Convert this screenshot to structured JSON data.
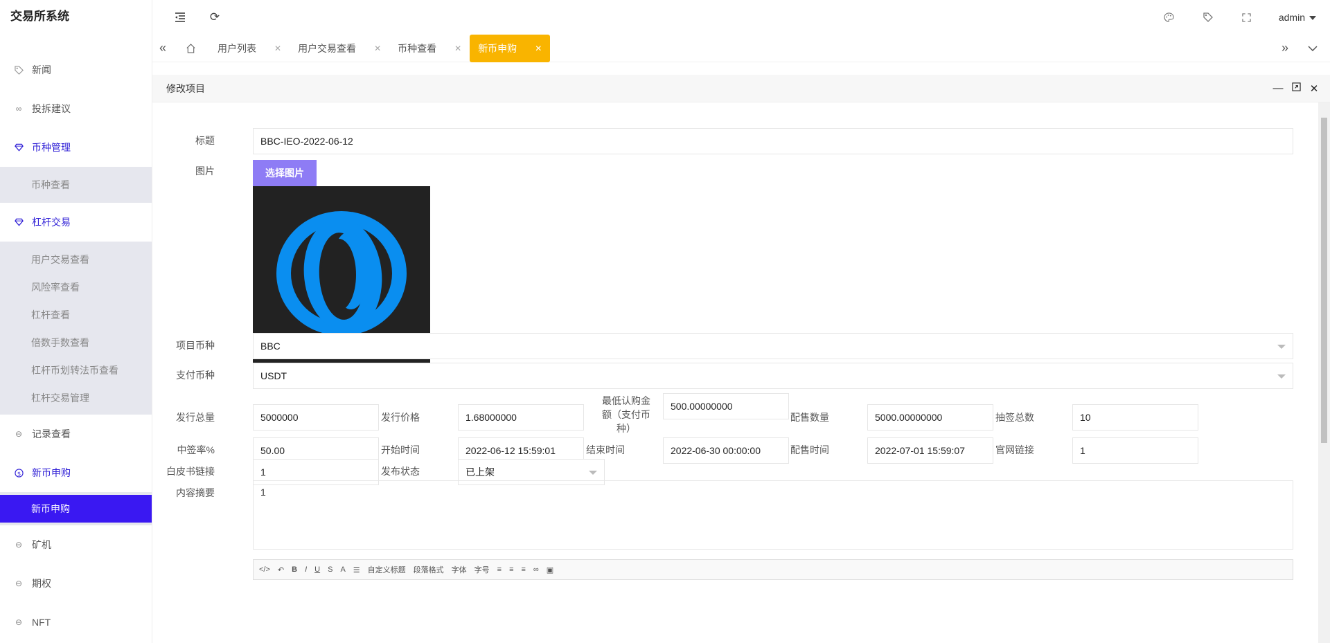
{
  "brand": "交易所系统",
  "sidebar": {
    "items": [
      {
        "label": "新闻"
      },
      {
        "label": "投拆建议"
      },
      {
        "label": "币种管理"
      },
      {
        "label": "杠杆交易"
      },
      {
        "label": "记录查看"
      },
      {
        "label": "新币申购"
      },
      {
        "label": "矿机"
      },
      {
        "label": "期权"
      },
      {
        "label": "NFT"
      }
    ],
    "coin_sub": [
      "币种查看"
    ],
    "lever_sub": [
      "用户交易查看",
      "风险率查看",
      "杠杆查看",
      "倍数手数查看",
      "杠杆币划转法币查看",
      "杠杆交易管理"
    ],
    "ipo_sub": [
      "新币申购"
    ]
  },
  "topbar": {
    "user": "admin"
  },
  "tabs": [
    {
      "label": "用户列表"
    },
    {
      "label": "用户交易查看"
    },
    {
      "label": "币种查看"
    },
    {
      "label": "新币申购"
    }
  ],
  "panel": {
    "title": "修改项目"
  },
  "form": {
    "title_label": "标题",
    "title_value": "BBC-IEO-2022-06-12",
    "image_label": "图片",
    "choose_image": "选择图片",
    "coin_label": "项目币种",
    "coin_value": "BBC",
    "pay_label": "支付币种",
    "pay_value": "USDT",
    "total_label": "发行总量",
    "total_value": "5000000",
    "price_label": "发行价格",
    "price_value": "1.68000000",
    "min_label": "最低认购金额（支付币种）",
    "min_value": "500.00000000",
    "alloc_label": "配售数量",
    "alloc_value": "5000.00000000",
    "lottery_label": "抽签总数",
    "lottery_value": "10",
    "rate_label": "中签率%",
    "rate_value": "50.00",
    "start_label": "开始时间",
    "start_value": "2022-06-12 15:59:01",
    "end_label": "结束时间",
    "end_value": "2022-06-30 00:00:00",
    "alloc_time_label": "配售时间",
    "alloc_time_value": "2022-07-01 15:59:07",
    "site_label": "官网链接",
    "site_value": "1",
    "white_label": "白皮书链接",
    "white_value": "1",
    "status_label": "发布状态",
    "status_value": "已上架",
    "summary_label": "内容摘要",
    "summary_value": "1"
  },
  "editor_toolbar": [
    "自定义标题",
    "段落格式",
    "字体",
    "字号"
  ],
  "colors": {
    "accent": "#3a18f2",
    "active_tab": "#f9b400",
    "logo_blue": "#0a8ef0",
    "button": "#8e7cf5"
  }
}
